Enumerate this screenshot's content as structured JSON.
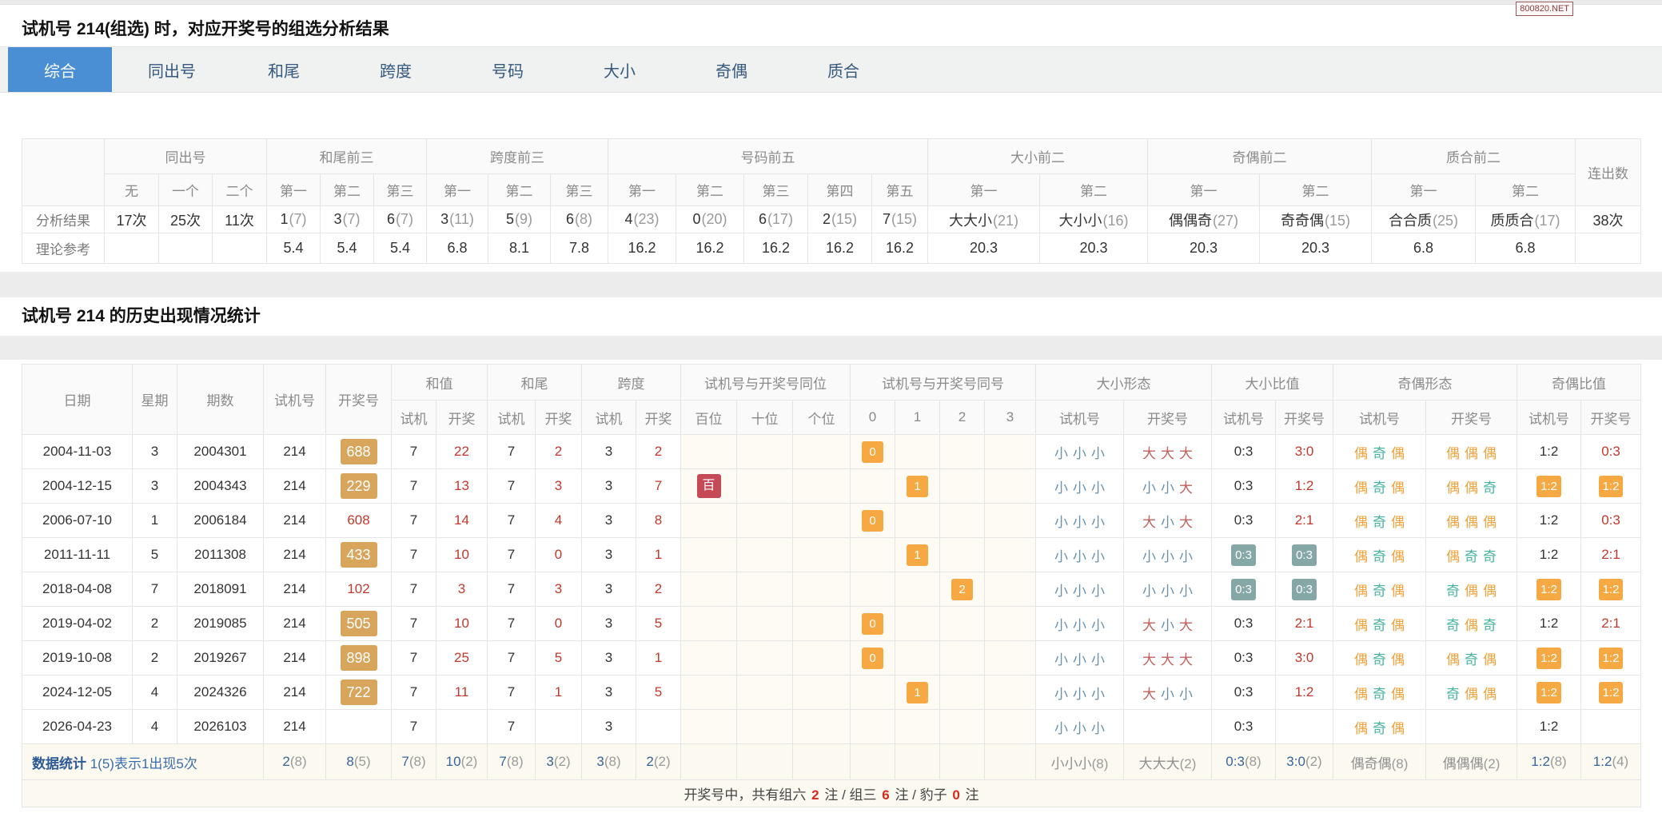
{
  "page": {
    "corner_link": "800820.NET"
  },
  "colors": {
    "accent_blue": "#4a8fd3",
    "badge_gold": "#d8a55c",
    "badge_orange": "#f6a842",
    "badge_teal": "#85a8a6",
    "badge_crimson": "#c64a56",
    "text_red": "#c0392b",
    "small_blue": "#6890ad",
    "big_red": "#c4605c",
    "even_orange": "#f0a33c",
    "odd_teal": "#45b2a0",
    "stat_blue": "#36649f"
  },
  "analysis": {
    "title": "试机号 214(组选) 时，对应开奖号的组选分析结果",
    "tabs": [
      {
        "label": "综合",
        "active": true
      },
      {
        "label": "同出号",
        "active": false
      },
      {
        "label": "和尾",
        "active": false
      },
      {
        "label": "跨度",
        "active": false
      },
      {
        "label": "号码",
        "active": false
      },
      {
        "label": "大小",
        "active": false
      },
      {
        "label": "奇偶",
        "active": false
      },
      {
        "label": "质合",
        "active": false
      }
    ],
    "table": {
      "groups": [
        {
          "label": "",
          "cols": null
        },
        {
          "label": "同出号",
          "cols": [
            "无",
            "一个",
            "二个"
          ]
        },
        {
          "label": "和尾前三",
          "cols": [
            "第一",
            "第二",
            "第三"
          ]
        },
        {
          "label": "跨度前三",
          "cols": [
            "第一",
            "第二",
            "第三"
          ]
        },
        {
          "label": "号码前五",
          "cols": [
            "第一",
            "第二",
            "第三",
            "第四",
            "第五"
          ]
        },
        {
          "label": "大小前二",
          "cols": [
            "第一",
            "第二"
          ]
        },
        {
          "label": "奇偶前二",
          "cols": [
            "第一",
            "第二"
          ]
        },
        {
          "label": "质合前二",
          "cols": [
            "第一",
            "第二"
          ]
        },
        {
          "label": "连出数",
          "cols": null
        }
      ],
      "rows": [
        {
          "label": "分析结果",
          "cells": [
            {
              "v": "17次"
            },
            {
              "v": "25次"
            },
            {
              "v": "11次"
            },
            {
              "v": "1",
              "p": "(7)"
            },
            {
              "v": "3",
              "p": "(7)"
            },
            {
              "v": "6",
              "p": "(7)"
            },
            {
              "v": "3",
              "p": "(11)"
            },
            {
              "v": "5",
              "p": "(9)"
            },
            {
              "v": "6",
              "p": "(8)"
            },
            {
              "v": "4",
              "p": "(23)"
            },
            {
              "v": "0",
              "p": "(20)"
            },
            {
              "v": "6",
              "p": "(17)"
            },
            {
              "v": "2",
              "p": "(15)"
            },
            {
              "v": "7",
              "p": "(15)"
            },
            {
              "v": "大大小",
              "p": "(21)"
            },
            {
              "v": "大小小",
              "p": "(16)"
            },
            {
              "v": "偶偶奇",
              "p": "(27)"
            },
            {
              "v": "奇奇偶",
              "p": "(15)"
            },
            {
              "v": "合合质",
              "p": "(25)"
            },
            {
              "v": "质质合",
              "p": "(17)"
            },
            {
              "v": "38次"
            }
          ]
        },
        {
          "label": "理论参考",
          "cells": [
            {},
            {},
            {},
            {
              "v": "5.4"
            },
            {
              "v": "5.4"
            },
            {
              "v": "5.4"
            },
            {
              "v": "6.8"
            },
            {
              "v": "8.1"
            },
            {
              "v": "7.8"
            },
            {
              "v": "16.2"
            },
            {
              "v": "16.2"
            },
            {
              "v": "16.2"
            },
            {
              "v": "16.2"
            },
            {
              "v": "16.2"
            },
            {
              "v": "20.3"
            },
            {
              "v": "20.3"
            },
            {
              "v": "20.3"
            },
            {
              "v": "20.3"
            },
            {
              "v": "6.8"
            },
            {
              "v": "6.8"
            },
            {}
          ]
        }
      ]
    }
  },
  "history": {
    "title": "试机号 214 的历史出现情况统计",
    "table": {
      "groups": [
        {
          "label": "日期",
          "cols": null
        },
        {
          "label": "星期",
          "cols": null
        },
        {
          "label": "期数",
          "cols": null
        },
        {
          "label": "试机号",
          "cols": null
        },
        {
          "label": "开奖号",
          "cols": null
        },
        {
          "label": "和值",
          "cols": [
            "试机",
            "开奖"
          ]
        },
        {
          "label": "和尾",
          "cols": [
            "试机",
            "开奖"
          ]
        },
        {
          "label": "跨度",
          "cols": [
            "试机",
            "开奖"
          ]
        },
        {
          "label": "试机号与开奖号同位",
          "cols": [
            "百位",
            "十位",
            "个位"
          ]
        },
        {
          "label": "试机号与开奖号同号",
          "cols": [
            "0",
            "1",
            "2",
            "3"
          ]
        },
        {
          "label": "大小形态",
          "cols": [
            "试机号",
            "开奖号"
          ]
        },
        {
          "label": "大小比值",
          "cols": [
            "试机号",
            "开奖号"
          ]
        },
        {
          "label": "奇偶形态",
          "cols": [
            "试机号",
            "开奖号"
          ]
        },
        {
          "label": "奇偶比值",
          "cols": [
            "试机号",
            "开奖号"
          ]
        }
      ],
      "rows": [
        [
          "2004-11-03",
          "3",
          "2004301",
          "214",
          {
            "t": "688",
            "k": "gold"
          },
          "7",
          {
            "t": "22",
            "k": "red"
          },
          "7",
          {
            "t": "2",
            "k": "red"
          },
          "3",
          {
            "t": "2",
            "k": "red"
          },
          "",
          "",
          "",
          {
            "t": "0",
            "k": "orangeb"
          },
          "",
          "",
          "",
          {
            "t": "小小小",
            "k": "seq"
          },
          {
            "t": "大大大",
            "k": "seq"
          },
          "0:3",
          {
            "t": "3:0",
            "k": "red"
          },
          {
            "t": "偶奇偶",
            "k": "seq"
          },
          {
            "t": "偶偶偶",
            "k": "seq"
          },
          "1:2",
          {
            "t": "0:3",
            "k": "red"
          }
        ],
        [
          "2004-12-15",
          "3",
          "2004343",
          "214",
          {
            "t": "229",
            "k": "gold"
          },
          "7",
          {
            "t": "13",
            "k": "red"
          },
          "7",
          {
            "t": "3",
            "k": "red"
          },
          "3",
          {
            "t": "7",
            "k": "red"
          },
          {
            "t": "百",
            "k": "crimson"
          },
          "",
          "",
          "",
          {
            "t": "1",
            "k": "orangeb"
          },
          "",
          "",
          {
            "t": "小小小",
            "k": "seq"
          },
          {
            "t": "小小大",
            "k": "seq"
          },
          "0:3",
          {
            "t": "1:2",
            "k": "red"
          },
          {
            "t": "偶奇偶",
            "k": "seq"
          },
          {
            "t": "偶偶奇",
            "k": "seq"
          },
          {
            "t": "1:2",
            "k": "orangeb"
          },
          {
            "t": "1:2",
            "k": "orangeb"
          }
        ],
        [
          "2006-07-10",
          "1",
          "2006184",
          "214",
          {
            "t": "608",
            "k": "red"
          },
          "7",
          {
            "t": "14",
            "k": "red"
          },
          "7",
          {
            "t": "4",
            "k": "red"
          },
          "3",
          {
            "t": "8",
            "k": "red"
          },
          "",
          "",
          "",
          {
            "t": "0",
            "k": "orangeb"
          },
          "",
          "",
          "",
          {
            "t": "小小小",
            "k": "seq"
          },
          {
            "t": "大小大",
            "k": "seq"
          },
          "0:3",
          {
            "t": "2:1",
            "k": "red"
          },
          {
            "t": "偶奇偶",
            "k": "seq"
          },
          {
            "t": "偶偶偶",
            "k": "seq"
          },
          "1:2",
          {
            "t": "0:3",
            "k": "red"
          }
        ],
        [
          "2011-11-11",
          "5",
          "2011308",
          "214",
          {
            "t": "433",
            "k": "gold"
          },
          "7",
          {
            "t": "10",
            "k": "red"
          },
          "7",
          {
            "t": "0",
            "k": "red"
          },
          "3",
          {
            "t": "1",
            "k": "red"
          },
          "",
          "",
          "",
          "",
          {
            "t": "1",
            "k": "orangeb"
          },
          "",
          "",
          {
            "t": "小小小",
            "k": "seq"
          },
          {
            "t": "小小小",
            "k": "seq"
          },
          {
            "t": "0:3",
            "k": "tealb"
          },
          {
            "t": "0:3",
            "k": "tealb"
          },
          {
            "t": "偶奇偶",
            "k": "seq"
          },
          {
            "t": "偶奇奇",
            "k": "seq"
          },
          "1:2",
          {
            "t": "2:1",
            "k": "red"
          }
        ],
        [
          "2018-04-08",
          "7",
          "2018091",
          "214",
          {
            "t": "102",
            "k": "red"
          },
          "7",
          {
            "t": "3",
            "k": "red"
          },
          "7",
          {
            "t": "3",
            "k": "red"
          },
          "3",
          {
            "t": "2",
            "k": "red"
          },
          "",
          "",
          "",
          "",
          "",
          {
            "t": "2",
            "k": "orangeb"
          },
          "",
          {
            "t": "小小小",
            "k": "seq"
          },
          {
            "t": "小小小",
            "k": "seq"
          },
          {
            "t": "0:3",
            "k": "tealb"
          },
          {
            "t": "0:3",
            "k": "tealb"
          },
          {
            "t": "偶奇偶",
            "k": "seq"
          },
          {
            "t": "奇偶偶",
            "k": "seq"
          },
          {
            "t": "1:2",
            "k": "orangeb"
          },
          {
            "t": "1:2",
            "k": "orangeb"
          }
        ],
        [
          "2019-04-02",
          "2",
          "2019085",
          "214",
          {
            "t": "505",
            "k": "gold"
          },
          "7",
          {
            "t": "10",
            "k": "red"
          },
          "7",
          {
            "t": "0",
            "k": "red"
          },
          "3",
          {
            "t": "5",
            "k": "red"
          },
          "",
          "",
          "",
          {
            "t": "0",
            "k": "orangeb"
          },
          "",
          "",
          "",
          {
            "t": "小小小",
            "k": "seq"
          },
          {
            "t": "大小大",
            "k": "seq"
          },
          "0:3",
          {
            "t": "2:1",
            "k": "red"
          },
          {
            "t": "偶奇偶",
            "k": "seq"
          },
          {
            "t": "奇偶奇",
            "k": "seq"
          },
          "1:2",
          {
            "t": "2:1",
            "k": "red"
          }
        ],
        [
          "2019-10-08",
          "2",
          "2019267",
          "214",
          {
            "t": "898",
            "k": "gold"
          },
          "7",
          {
            "t": "25",
            "k": "red"
          },
          "7",
          {
            "t": "5",
            "k": "red"
          },
          "3",
          {
            "t": "1",
            "k": "red"
          },
          "",
          "",
          "",
          {
            "t": "0",
            "k": "orangeb"
          },
          "",
          "",
          "",
          {
            "t": "小小小",
            "k": "seq"
          },
          {
            "t": "大大大",
            "k": "seq"
          },
          "0:3",
          {
            "t": "3:0",
            "k": "red"
          },
          {
            "t": "偶奇偶",
            "k": "seq"
          },
          {
            "t": "偶奇偶",
            "k": "seq"
          },
          {
            "t": "1:2",
            "k": "orangeb"
          },
          {
            "t": "1:2",
            "k": "orangeb"
          }
        ],
        [
          "2024-12-05",
          "4",
          "2024326",
          "214",
          {
            "t": "722",
            "k": "gold"
          },
          "7",
          {
            "t": "11",
            "k": "red"
          },
          "7",
          {
            "t": "1",
            "k": "red"
          },
          "3",
          {
            "t": "5",
            "k": "red"
          },
          "",
          "",
          "",
          "",
          {
            "t": "1",
            "k": "orangeb"
          },
          "",
          "",
          {
            "t": "小小小",
            "k": "seq"
          },
          {
            "t": "大小小",
            "k": "seq"
          },
          "0:3",
          {
            "t": "1:2",
            "k": "red"
          },
          {
            "t": "偶奇偶",
            "k": "seq"
          },
          {
            "t": "奇偶偶",
            "k": "seq"
          },
          {
            "t": "1:2",
            "k": "orangeb"
          },
          {
            "t": "1:2",
            "k": "orangeb"
          }
        ],
        [
          "2026-04-23",
          "4",
          "2026103",
          "214",
          "",
          "7",
          "",
          "7",
          "",
          "3",
          "",
          "",
          "",
          "",
          "",
          "",
          "",
          "",
          {
            "t": "小小小",
            "k": "seq"
          },
          "",
          "0:3",
          "",
          {
            "t": "偶奇偶",
            "k": "seq"
          },
          "",
          "1:2",
          ""
        ]
      ],
      "stats": {
        "label_strong": "数据统计",
        "label_rest": " 1(5)表示1出现5次",
        "cells": [
          {
            "v": "2",
            "p": "(8)"
          },
          {
            "v": "8",
            "p": "(5)"
          },
          {
            "v": "7",
            "p": "(8)"
          },
          {
            "v": "10",
            "p": "(2)"
          },
          {
            "v": "7",
            "p": "(8)"
          },
          {
            "v": "3",
            "p": "(2)"
          },
          {
            "v": "3",
            "p": "(8)"
          },
          {
            "v": "2",
            "p": "(2)"
          },
          "",
          "",
          "",
          "",
          "",
          "",
          "",
          {
            "v": "小小小",
            "p": "(8)",
            "g": 1
          },
          {
            "v": "大大大",
            "p": "(2)",
            "g": 1
          },
          {
            "v": "0:3",
            "p": "(8)"
          },
          {
            "v": "3:0",
            "p": "(2)"
          },
          {
            "v": "偶奇偶",
            "p": "(8)",
            "g": 1
          },
          {
            "v": "偶偶偶",
            "p": "(2)",
            "g": 1
          },
          {
            "v": "1:2",
            "p": "(8)"
          },
          {
            "v": "1:2",
            "p": "(4)"
          }
        ]
      },
      "footer": [
        {
          "t": "开奖号中，共有组六 "
        },
        {
          "t": "2",
          "red": true
        },
        {
          "t": " 注 / 组三 "
        },
        {
          "t": "6",
          "red": true
        },
        {
          "t": " 注 / 豹子 "
        },
        {
          "t": "0",
          "red": true
        },
        {
          "t": " 注"
        }
      ]
    }
  }
}
